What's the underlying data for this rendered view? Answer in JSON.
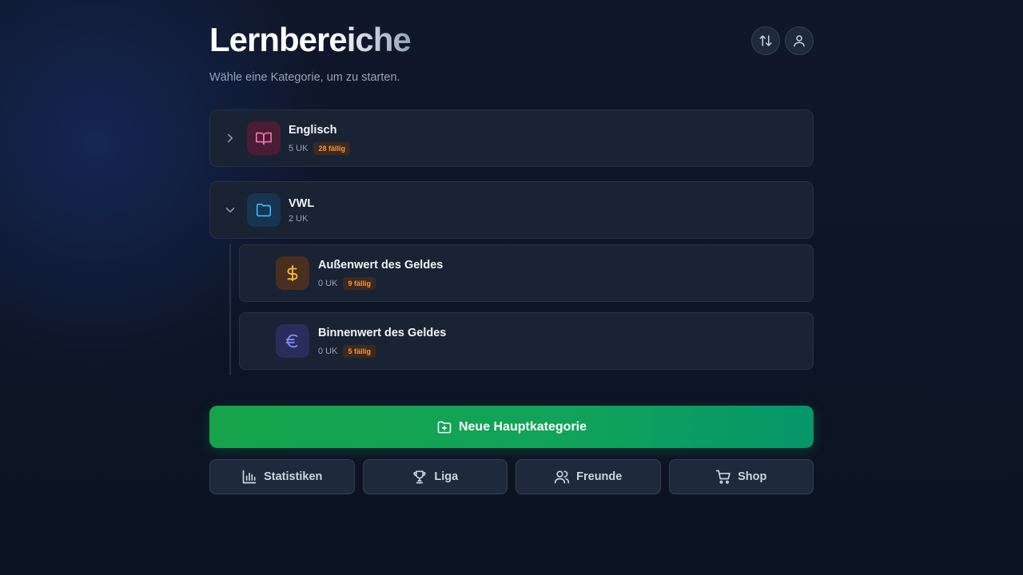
{
  "header": {
    "title": "Lernbereiche",
    "subtitle": "Wähle eine Kategorie, um zu starten.",
    "actions": [
      {
        "icon": "sort-icon"
      },
      {
        "icon": "user-icon"
      }
    ]
  },
  "categories": [
    {
      "name": "Englisch",
      "count": "5 UK",
      "due": "28 fällig",
      "icon": "book-icon",
      "icon_bg": "#4a1d35",
      "icon_color": "#f472b6",
      "expanded": false
    },
    {
      "name": "VWL",
      "count": "2 UK",
      "due": "",
      "icon": "folder-icon",
      "icon_bg": "#173451",
      "icon_color": "#38bdf8",
      "expanded": true,
      "children": [
        {
          "name": "Außenwert des Geldes",
          "count": "0 UK",
          "due": "9 fällig",
          "icon": "dollar-icon",
          "icon_bg": "#4a2e1f",
          "icon_color": "#fbbf24"
        },
        {
          "name": "Binnenwert des Geldes",
          "count": "0 UK",
          "due": "5 fällig",
          "icon": "euro-icon",
          "icon_bg": "#2a2d5c",
          "icon_color": "#818cf8"
        }
      ]
    }
  ],
  "primary_action": {
    "label": "Neue Hauptkategorie",
    "icon": "folder-plus-icon",
    "color": "#16a34a"
  },
  "nav": [
    {
      "label": "Statistiken",
      "icon": "bar-chart-icon"
    },
    {
      "label": "Liga",
      "icon": "trophy-icon"
    },
    {
      "label": "Freunde",
      "icon": "users-icon"
    },
    {
      "label": "Shop",
      "icon": "cart-icon"
    }
  ],
  "colors": {
    "background": "#0f172a",
    "card": "#1a2333",
    "badge_text": "#fb923c",
    "badge_bg": "#3b2a1f"
  }
}
